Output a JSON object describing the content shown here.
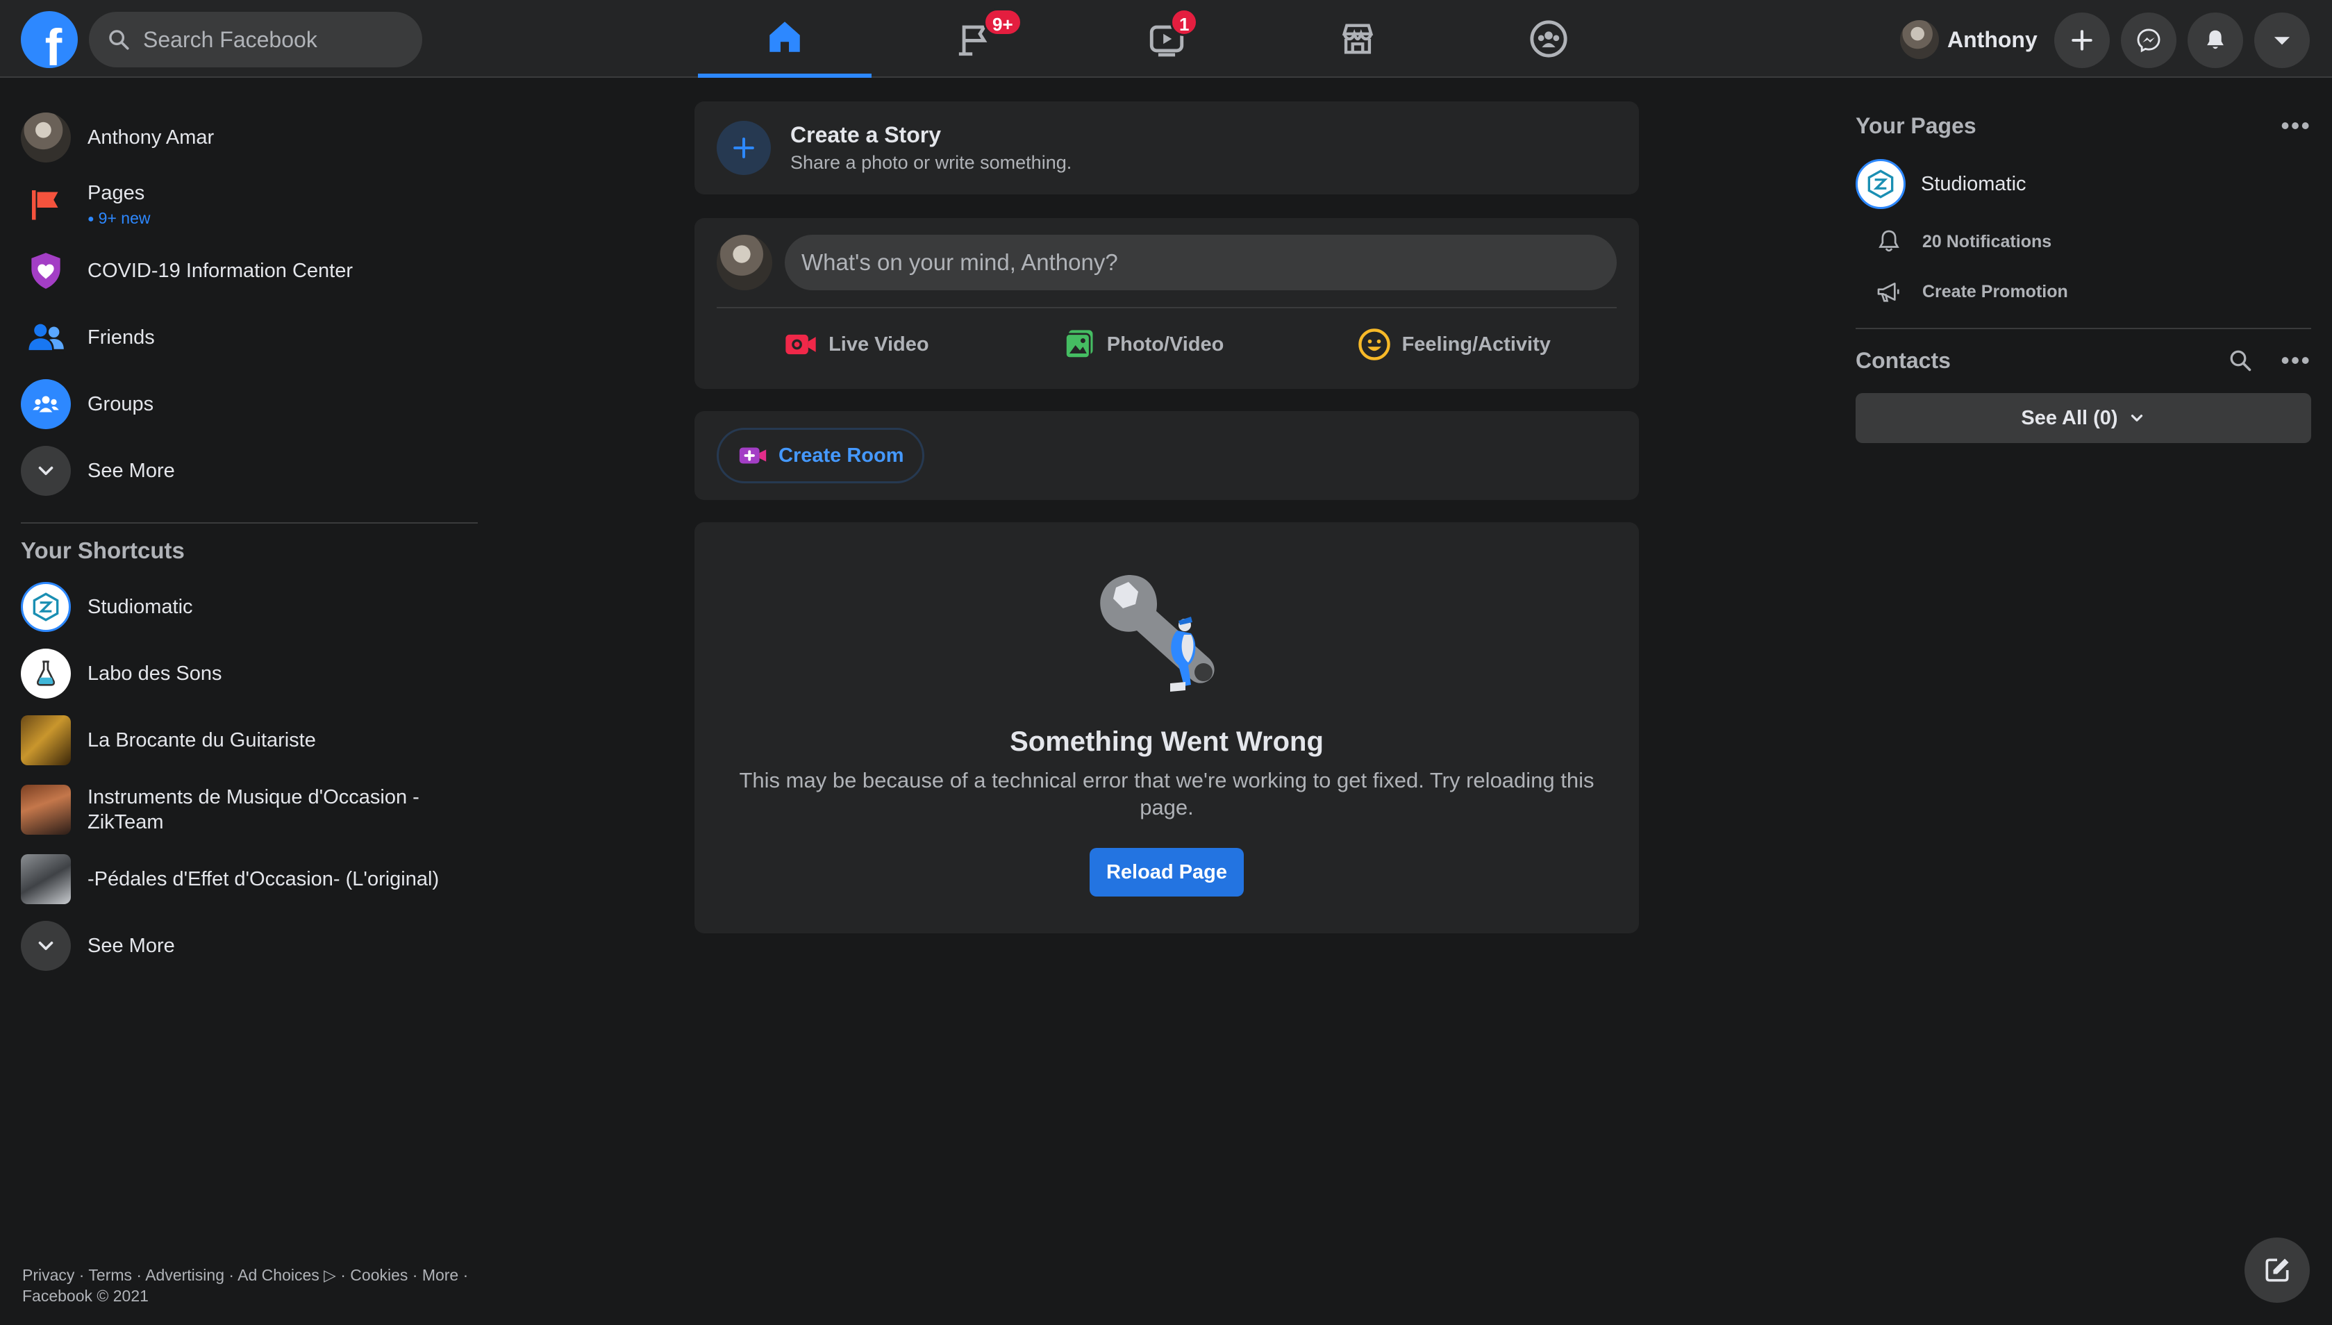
{
  "header": {
    "logo_letter": "f",
    "search_placeholder": "Search Facebook",
    "nav_badges": {
      "pages": "9+",
      "watch": "1"
    },
    "profile_name": "Anthony"
  },
  "left": {
    "items": [
      {
        "label": "Anthony Amar"
      },
      {
        "label": "Pages",
        "sub": "9+ new"
      },
      {
        "label": "COVID-19 Information Center"
      },
      {
        "label": "Friends"
      },
      {
        "label": "Groups"
      },
      {
        "label": "See More"
      }
    ],
    "shortcuts_title": "Your Shortcuts",
    "shortcuts": [
      {
        "label": "Studiomatic"
      },
      {
        "label": "Labo des Sons"
      },
      {
        "label": "La Brocante du Guitariste"
      },
      {
        "label": "Instruments de Musique d'Occasion - ZikTeam"
      },
      {
        "label": "-Pédales d'Effet d'Occasion- (L'original)"
      },
      {
        "label": "See More"
      }
    ],
    "footer": "Privacy · Terms · Advertising · Ad Choices ▷ · Cookies · More · Facebook © 2021"
  },
  "center": {
    "story": {
      "title": "Create a Story",
      "subtitle": "Share a photo or write something."
    },
    "composer": {
      "placeholder": "What's on your mind, Anthony?",
      "actions": [
        "Live Video",
        "Photo/Video",
        "Feeling/Activity"
      ]
    },
    "room_button": "Create Room",
    "error": {
      "title": "Something Went Wrong",
      "message": "This may be because of a technical error that we're working to get fixed. Try reloading this page.",
      "button": "Reload Page"
    }
  },
  "right": {
    "pages_title": "Your Pages",
    "page_name": "Studiomatic",
    "notifications": "20 Notifications",
    "promotion": "Create Promotion",
    "contacts_title": "Contacts",
    "see_all": "See All (0)"
  },
  "colors": {
    "background": "#18191a",
    "surface": "#242526",
    "accent": "#2d88ff",
    "badge": "#e41e3f"
  }
}
